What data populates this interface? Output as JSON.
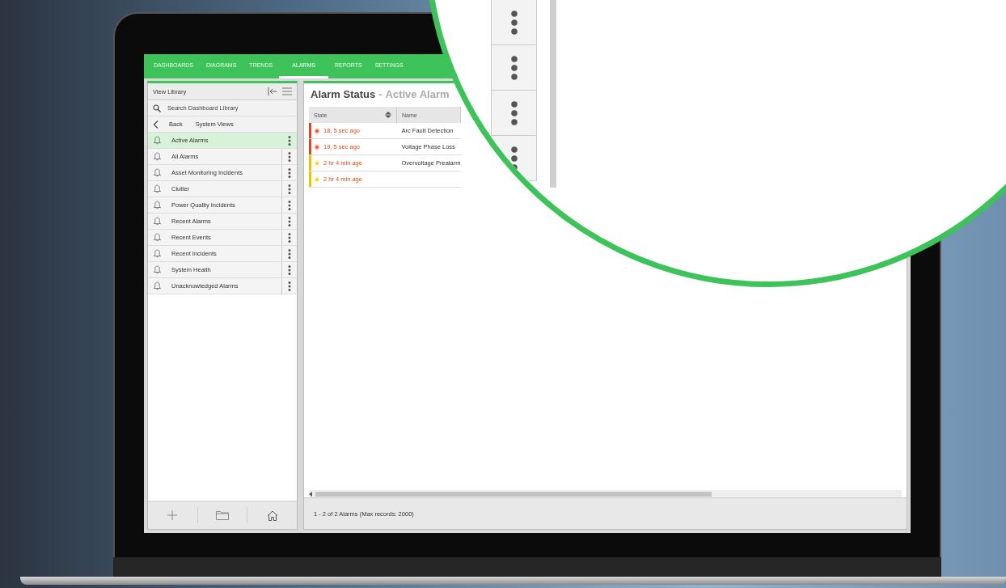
{
  "nav": {
    "tabs": [
      {
        "label": "DASHBOARDS",
        "selected": false
      },
      {
        "label": "DIAGRAMS",
        "selected": false
      },
      {
        "label": "TRENDS",
        "selected": false
      },
      {
        "label": "ALARMS",
        "selected": true
      },
      {
        "label": "REPORTS",
        "selected": false
      },
      {
        "label": "SETTINGS",
        "selected": false
      }
    ]
  },
  "sidebar": {
    "title": "View Library",
    "search": {
      "placeholder": "Search Dashboard Library"
    },
    "back": "Back",
    "folder": "System Views",
    "items": [
      {
        "label": "Active Alarms",
        "selected": true
      },
      {
        "label": "All Alarms",
        "selected": false
      },
      {
        "label": "Asset Monitoring Incidents",
        "selected": false
      },
      {
        "label": "Clutter",
        "selected": false
      },
      {
        "label": "Power Quality Incidents",
        "selected": false
      },
      {
        "label": "Recent Alarms",
        "selected": false
      },
      {
        "label": "Recent Events",
        "selected": false
      },
      {
        "label": "Recent Incidents",
        "selected": false
      },
      {
        "label": "System Health",
        "selected": false
      },
      {
        "label": "Unacknowledged Alarms",
        "selected": false
      }
    ]
  },
  "main": {
    "title": "Alarm Status",
    "separator": "-",
    "subtitle": "Active Alarm",
    "table": {
      "columns": [
        "State",
        "Name"
      ],
      "rows": [
        {
          "kind": "critical",
          "state": "18, 5 sec ago",
          "name": "Arc Fault Detection"
        },
        {
          "kind": "critical",
          "state": "19, 5 sec ago",
          "name": "Voltage Phase Loss"
        },
        {
          "kind": "warning",
          "state": "2 hr 4 min age",
          "name": "Overvoltage Prealarm"
        },
        {
          "kind": "warning",
          "state": "2 hr 4 min age"
        }
      ]
    },
    "status": "1 - 2 of 2 Alarms (Max records: 2000)"
  }
}
